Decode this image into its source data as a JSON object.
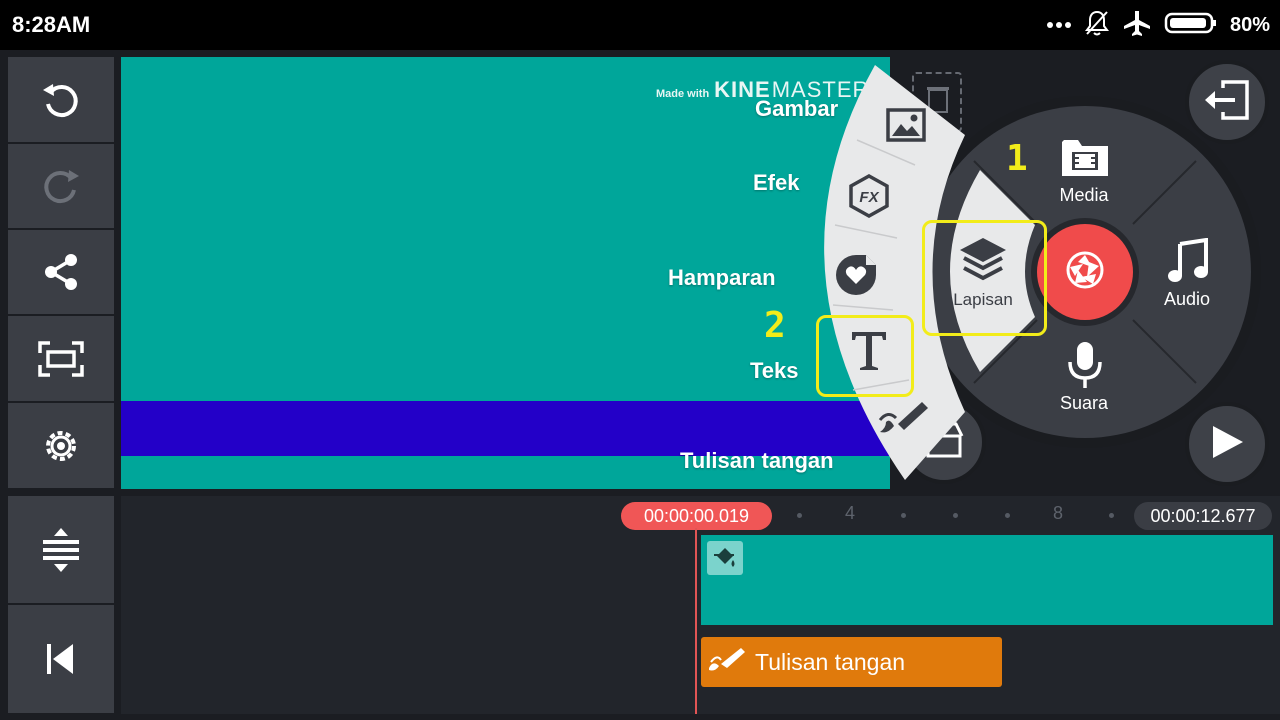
{
  "status_bar": {
    "time": "8:28AM",
    "battery_percent": "80%",
    "icons": [
      "more-dots-icon",
      "notifications-off-icon",
      "airplane-icon",
      "battery-icon"
    ]
  },
  "toolbar": {
    "icons": [
      "undo-icon",
      "redo-icon",
      "share-icon",
      "fullscreen-icon",
      "settings-icon",
      "timeline-expand-icon",
      "skip-to-start-icon"
    ]
  },
  "preview": {
    "watermark_prefix": "Made with",
    "watermark_brand_a": "KINE",
    "watermark_brand_b": "MASTER",
    "colors": {
      "background": "#00a69a",
      "bar": "#2300c8"
    }
  },
  "media_wheel": {
    "center_icon": "record-camera-icon",
    "center_color": "#f04b4b",
    "items": [
      {
        "label": "Media",
        "icon": "media-folder-icon"
      },
      {
        "label": "Audio",
        "icon": "music-note-icon"
      },
      {
        "label": "Suara",
        "icon": "microphone-icon"
      },
      {
        "label": "Lapisan",
        "icon": "layers-icon"
      }
    ]
  },
  "layer_menu": {
    "items": [
      {
        "label": "Gambar",
        "icon": "image-icon"
      },
      {
        "label": "Efek",
        "icon": "fx-icon"
      },
      {
        "label": "Hamparan",
        "icon": "sticker-heart-icon"
      },
      {
        "label": "Teks",
        "icon": "text-t-icon"
      },
      {
        "label": "Tulisan tangan",
        "icon": "handwriting-brush-icon"
      }
    ]
  },
  "annotations": {
    "step1": "1",
    "step2": "2",
    "highlight_color": "#f2ec1a"
  },
  "right_buttons": {
    "exit_icon": "exit-icon",
    "play_icon": "play-icon",
    "store_icon": "asset-store-icon",
    "delete_icon": "delete-icon"
  },
  "timeline": {
    "current_time": "00:00:00.019",
    "total_time": "00:00:12.677",
    "tick_labels": [
      "4",
      "8"
    ],
    "clips": [
      {
        "type": "color",
        "icon": "paint-bucket-icon",
        "color": "#00a69a"
      },
      {
        "type": "handwriting",
        "label": "Tulisan tangan",
        "icon": "handwriting-brush-icon",
        "color": "#e07a0c"
      }
    ]
  }
}
